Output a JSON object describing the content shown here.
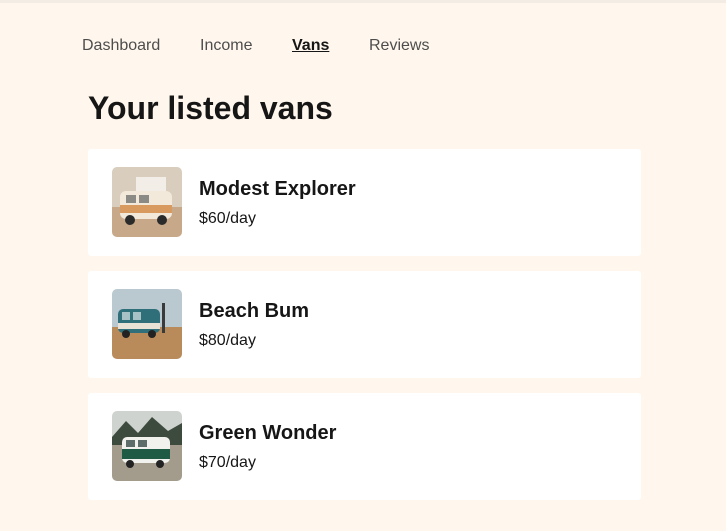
{
  "nav": {
    "items": [
      {
        "label": "Dashboard",
        "active": false
      },
      {
        "label": "Income",
        "active": false
      },
      {
        "label": "Vans",
        "active": true
      },
      {
        "label": "Reviews",
        "active": false
      }
    ]
  },
  "page": {
    "title": "Your listed vans"
  },
  "vans": [
    {
      "name": "Modest Explorer",
      "price": "$60/day",
      "image_icon": "van-photo-beige"
    },
    {
      "name": "Beach Bum",
      "price": "$80/day",
      "image_icon": "van-photo-teal"
    },
    {
      "name": "Green Wonder",
      "price": "$70/day",
      "image_icon": "van-photo-green"
    }
  ],
  "colors": {
    "background": "#FFF7ED",
    "card": "#FFFFFF",
    "text": "#161616",
    "nav_text": "#4D4D4D"
  }
}
